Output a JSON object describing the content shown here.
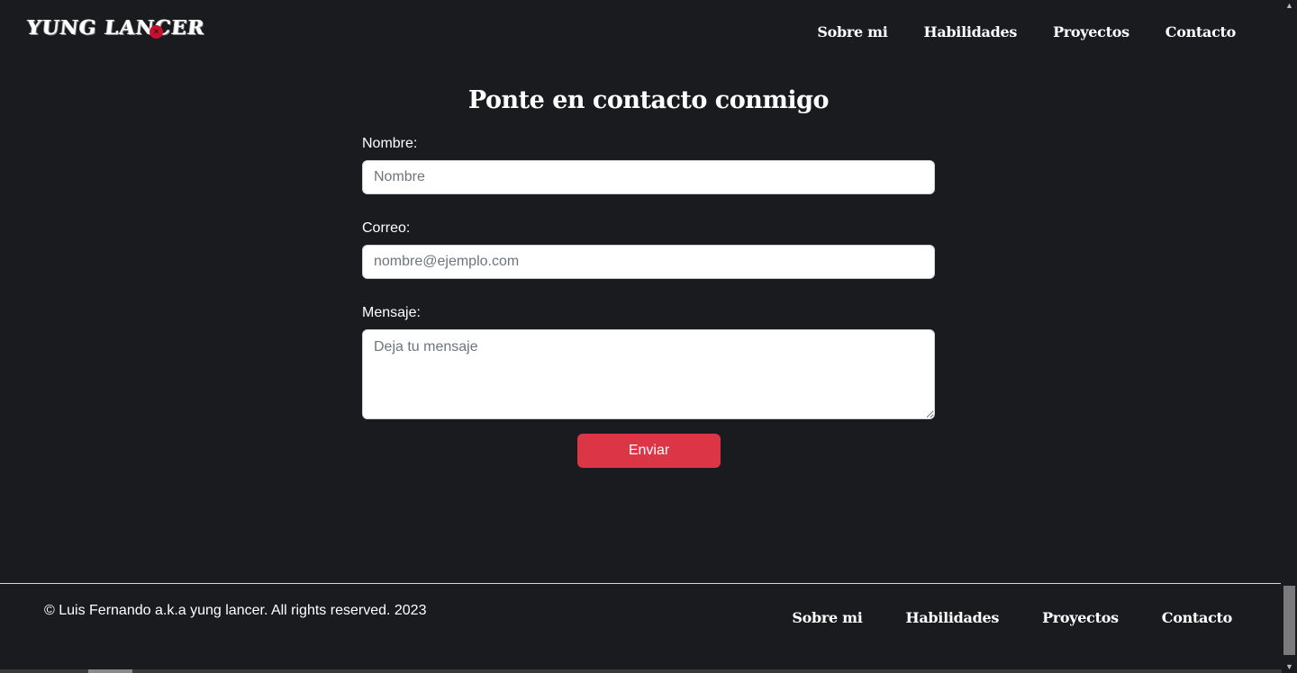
{
  "header": {
    "logo_text": "YUNG LANCER",
    "nav": [
      {
        "label": "Sobre mi"
      },
      {
        "label": "Habilidades"
      },
      {
        "label": "Proyectos"
      },
      {
        "label": "Contacto"
      }
    ]
  },
  "main": {
    "title": "Ponte en contacto conmigo",
    "form": {
      "name_label": "Nombre:",
      "name_placeholder": "Nombre",
      "email_label": "Correo:",
      "email_placeholder": "nombre@ejemplo.com",
      "message_label": "Mensaje:",
      "message_placeholder": "Deja tu mensaje",
      "submit_label": "Enviar"
    }
  },
  "footer": {
    "copyright": "© Luis Fernando a.k.a yung lancer. All rights reserved. 2023",
    "nav": [
      {
        "label": "Sobre mi"
      },
      {
        "label": "Habilidades"
      },
      {
        "label": "Proyectos"
      },
      {
        "label": "Contacto"
      }
    ]
  },
  "colors": {
    "background": "#1a1b1e",
    "accent": "#dc3545",
    "logo_dot": "#c8102e"
  }
}
